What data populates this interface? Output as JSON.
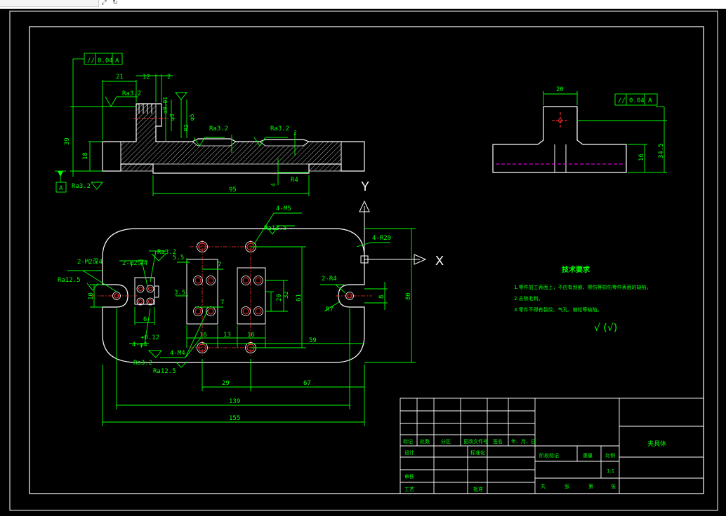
{
  "app": {
    "toolbar_icons": [
      "expand-icon",
      "refresh-icon"
    ]
  },
  "colors": {
    "background": "#000000",
    "drawing": "#ffffff",
    "dimension": "#00ff00",
    "hole": "#ff3030",
    "hidden_line": "#ff00ff"
  },
  "labels": {
    "ra32": "Ra3.2",
    "ra125": "Ra12.5",
    "datum": "A",
    "tol1": "0.04",
    "tol2": "0.04",
    "d21": "21",
    "d12": "12",
    "d2": "2",
    "d39": "39",
    "d18": "18",
    "d95": "95",
    "d4": "4",
    "d2b": "2",
    "r4": "R4",
    "tol_small": "±0.01",
    "phi3": "φ3",
    "phi5": "φ5",
    "r2": "R2",
    "d20_side": "20",
    "d34_5": "34.5",
    "d16_side": "16",
    "y_axis": "Y",
    "x_axis": "X",
    "hole_4m5": "4-M5",
    "r20": "4-R20",
    "two_r4": "2-R4",
    "r7": "R7",
    "two_m2": "2-M2深4",
    "two_phi2": "2-φ2深4",
    "d55": "5.5",
    "d7": "7",
    "d35": "3.5",
    "d7b": "7",
    "d20": "20",
    "d32": "32",
    "d61": "61",
    "d80": "80",
    "d8": "8",
    "d10": "10",
    "d6": "6",
    "d4phi4": "4-φ4",
    "tol012": "+0.12",
    "d4m4": "4-M4",
    "d16a": "16",
    "d13": "13",
    "d16b": "16",
    "d59": "59",
    "d29": "29",
    "d67": "67",
    "d139": "139",
    "d155": "155"
  },
  "notes": {
    "title": "技术要求",
    "items": [
      "1.零件加工表面上，不应有划痕、擦伤等损伤零件表面的缺陷。",
      "2.去除毛刺。",
      "3.零件不得有裂纹、气孔、缩松等缺陷。"
    ],
    "roughness": "√ (√)"
  },
  "title_block": {
    "part_name": "夹具体",
    "rev_headers": [
      "标记",
      "处数",
      "分区",
      "更改文件号",
      "签名",
      "年、月、日"
    ],
    "left_rows": [
      "设计",
      "审核",
      "工艺"
    ],
    "standard": "标准化",
    "approve": "批准",
    "stage_headers": [
      "阶段标记",
      "重量",
      "比例"
    ],
    "scale": "1:1",
    "sheet_labels": [
      "共",
      "张",
      "第",
      "张"
    ]
  }
}
